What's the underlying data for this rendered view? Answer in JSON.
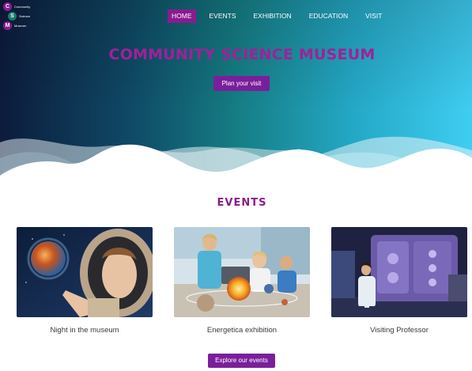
{
  "logo": {
    "letters": [
      "C",
      "S",
      "M"
    ],
    "words": [
      "Community",
      "Science",
      "Museum"
    ]
  },
  "nav": {
    "items": [
      "HOME",
      "EVENTS",
      "EXHIBITION",
      "EDUCATION",
      "VISIT"
    ],
    "active": "HOME"
  },
  "hero": {
    "title": "COMMUNITY SCIENCE MUSEUM",
    "cta": "Plan your visit"
  },
  "events": {
    "heading": "EVENTS",
    "cards": [
      {
        "caption": "Night in the museum"
      },
      {
        "caption": "Energetica exhibition"
      },
      {
        "caption": "Visiting Professor"
      }
    ],
    "cta": "Explore our events"
  },
  "colors": {
    "brand_purple": "#8a1c8f",
    "button_purple": "#7a1f9b",
    "gradient_start": "#0c1b3c",
    "gradient_end": "#3fcdf2"
  }
}
